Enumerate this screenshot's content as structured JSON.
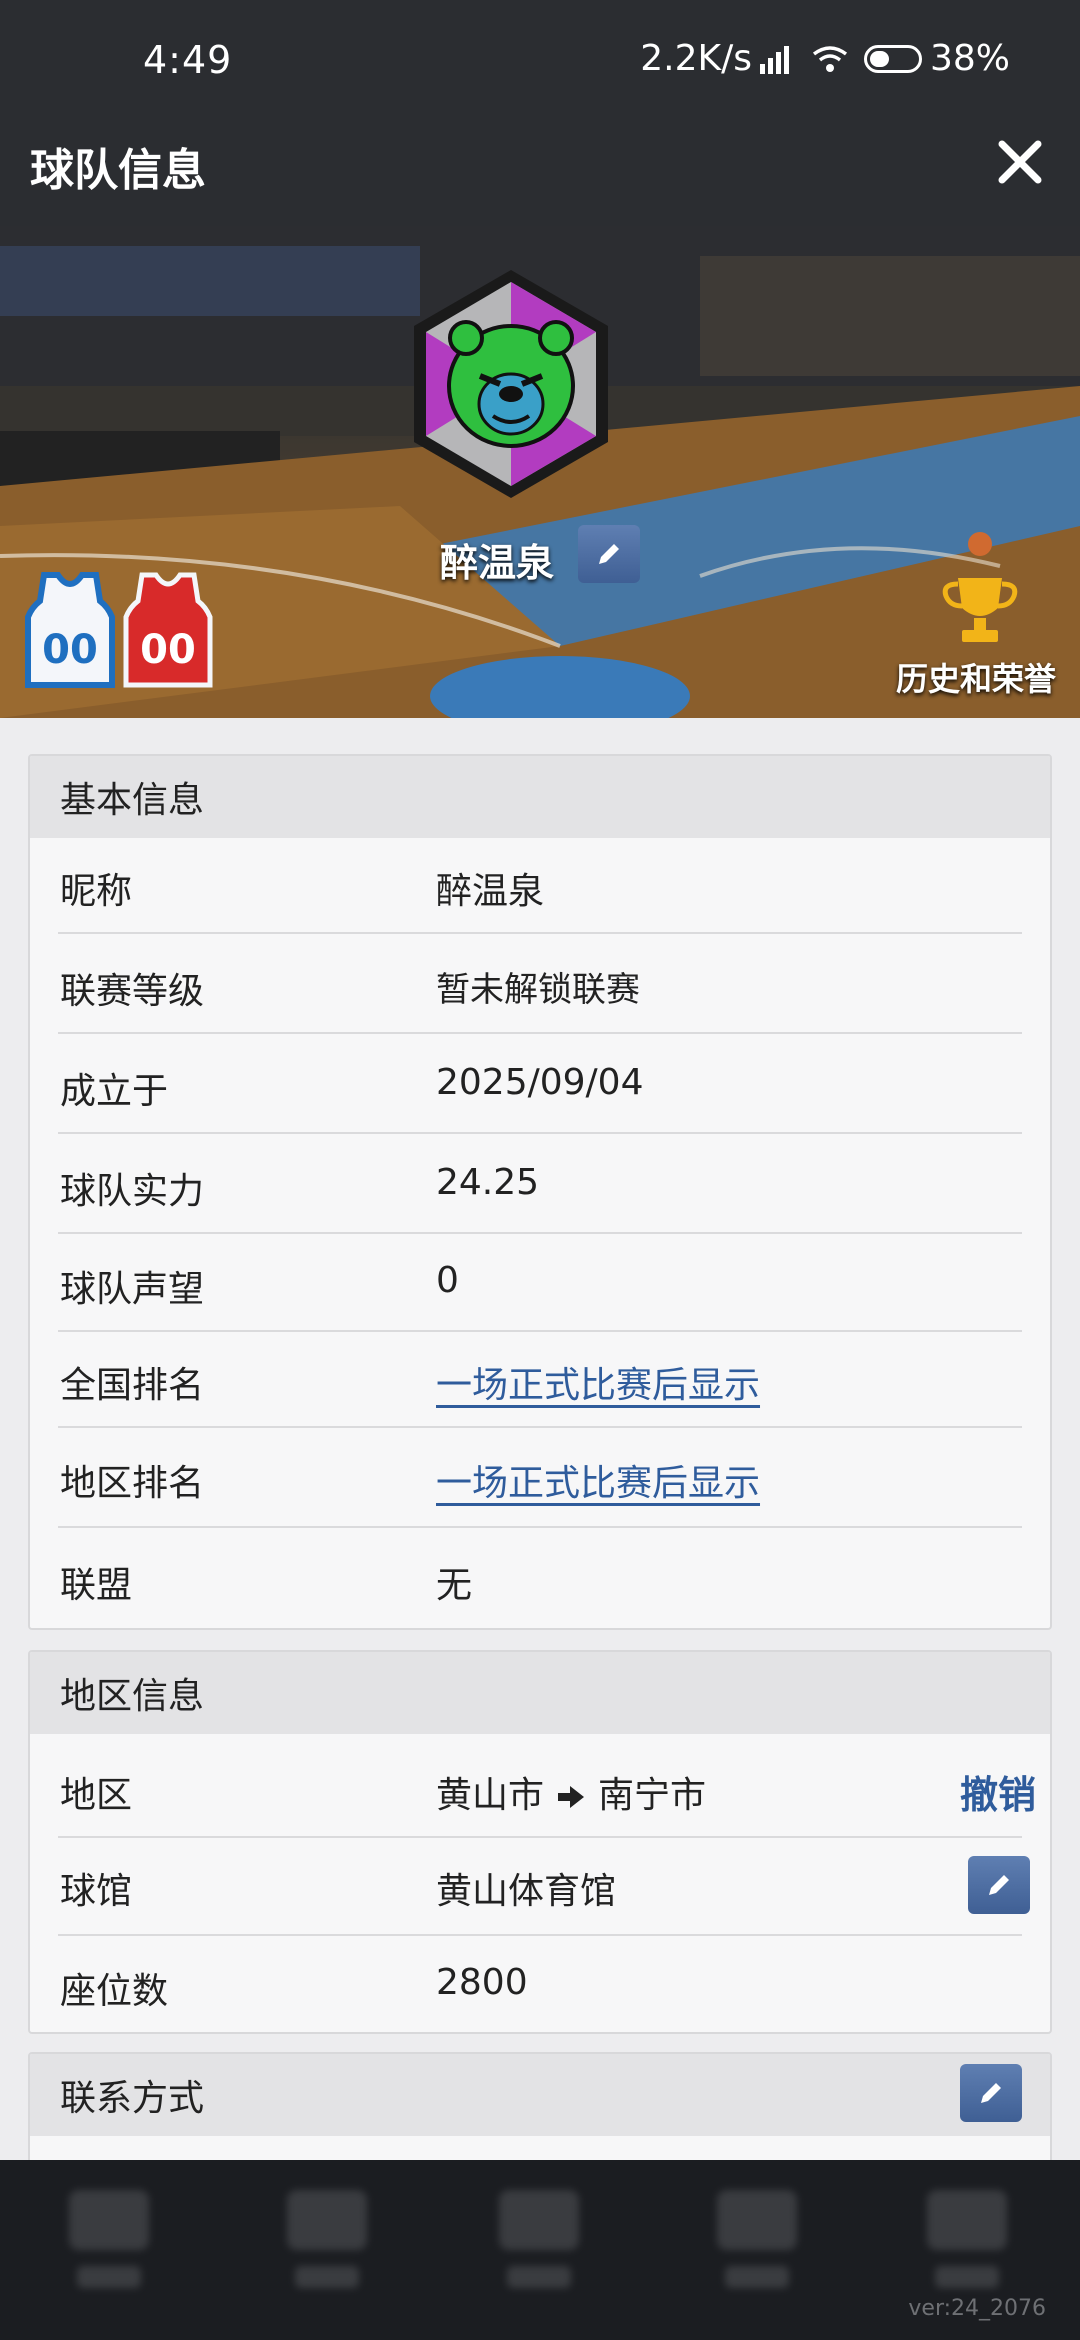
{
  "status_bar": {
    "time": "4:49",
    "net_speed": "2.2K/s",
    "battery": "38%"
  },
  "header": {
    "title": "球队信息",
    "close_icon": "close-icon"
  },
  "banner": {
    "team_name": "醉温泉",
    "home_jersey_number": "00",
    "away_jersey_number": "00",
    "history_label": "历史和荣誉",
    "colors": {
      "logo_purple": "#b23cc0",
      "logo_green": "#2fbf3f",
      "logo_blue": "#3aa0c8"
    }
  },
  "basic_info": {
    "title": "基本信息",
    "rows": [
      {
        "label": "昵称",
        "value": "醉温泉"
      },
      {
        "label": "联赛等级",
        "value": "暂未解锁联赛"
      },
      {
        "label": "成立于",
        "value": "2025/09/04"
      },
      {
        "label": "球队实力",
        "value": "24.25"
      },
      {
        "label": "球队声望",
        "value": "0"
      },
      {
        "label": "全国排名",
        "value": "一场正式比赛后显示"
      },
      {
        "label": "地区排名",
        "value": "一场正式比赛后显示"
      },
      {
        "label": "联盟",
        "value": "无"
      }
    ]
  },
  "region_info": {
    "title": "地区信息",
    "region_label": "地区",
    "region_from": "黄山市",
    "region_to": "南宁市",
    "revoke_label": "撤销",
    "arena_label": "球馆",
    "arena_value": "黄山体育馆",
    "seats_label": "座位数",
    "seats_value": "2800"
  },
  "contact_info": {
    "title": "联系方式"
  },
  "footer": {
    "version": "ver:24_2076"
  },
  "colors": {
    "accent_link": "#2f5c9c",
    "header_bg": "#2b2d31",
    "edit_button": "#4a6aa0"
  }
}
